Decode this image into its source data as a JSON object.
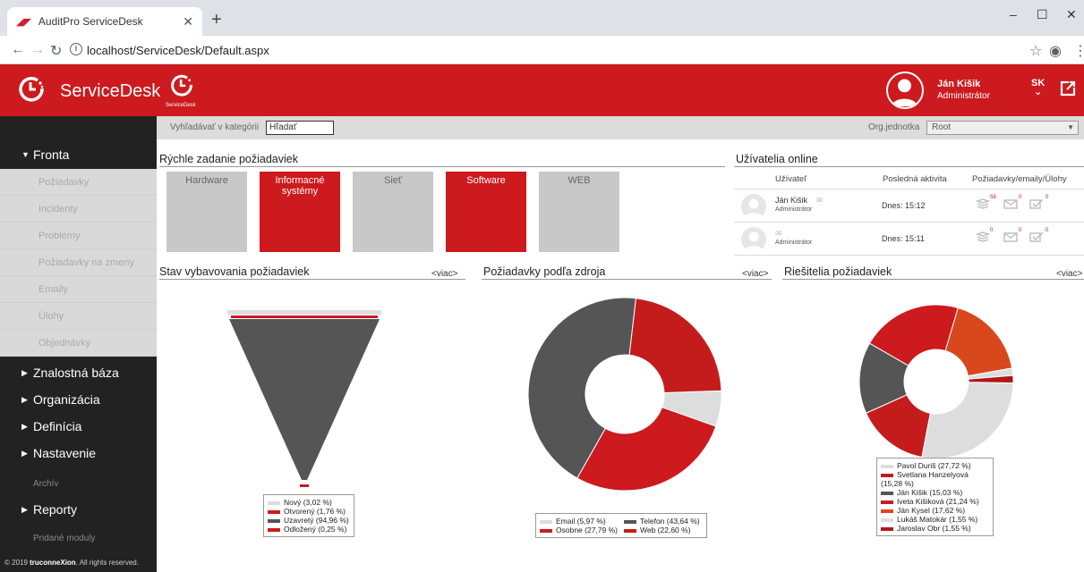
{
  "browser": {
    "tab_title": "AuditPro ServiceDesk",
    "url": "localhost/ServiceDesk/Default.aspx"
  },
  "header": {
    "brand": "ServiceDesk",
    "small_logo_text": "ServiceDesk",
    "user_name": "Ján Kišik",
    "user_role": "Administrátor",
    "lang": "SK"
  },
  "sidebar": {
    "fronta": "Fronta",
    "sub_items": [
      "Požiadavky",
      "Incidenty",
      "Problémy",
      "Požiadavky na zmeny",
      "Emaily",
      "Úlohy",
      "Objednávky"
    ],
    "sections": [
      "Znalostná báza",
      "Organizácia",
      "Definícia",
      "Nastavenie"
    ],
    "archiv": "Archív",
    "reporty": "Reporty",
    "pridane": "Pridané moduly",
    "copyright_prefix": "© 2019 ",
    "copyright_brand": "truconneXion",
    "copyright_suffix": ". All rights reserved."
  },
  "filter": {
    "search_label": "Vyhľadávať v kategórii",
    "search_value": "Hľadať",
    "org_label": "Org.jednotka",
    "org_value": "Root"
  },
  "quick": {
    "title": "Rýchle zadanie požiadaviek",
    "tiles": [
      {
        "label": "Hardware",
        "color": "grey"
      },
      {
        "label": "Informacné systémy",
        "color": "red"
      },
      {
        "label": "Sieť",
        "color": "grey"
      },
      {
        "label": "Software",
        "color": "red"
      },
      {
        "label": "WEB",
        "color": "grey"
      }
    ]
  },
  "online": {
    "title": "Užívatelia online",
    "col_user": "Užívateľ",
    "col_activity": "Posledná aktivita",
    "col_counts": "Požiadavky/emaily/Úlohy",
    "rows": [
      {
        "name": "Ján Kišik",
        "role": "Administrátor",
        "time": "Dnes: 15:12",
        "req": "58",
        "mail": "0",
        "task": "0"
      },
      {
        "name": "",
        "role": "Administrátor",
        "time": "Dnes: 15:11",
        "req": "0",
        "mail": "0",
        "task": "0"
      }
    ]
  },
  "widgets": {
    "more": "<viac>",
    "status_title": "Stav vybavovania požiadaviek",
    "source_title": "Požiadavky podľa zdroja",
    "solvers_title": "Riešitelia požiadaviek"
  },
  "colors": {
    "brand_red": "#cc1a1f",
    "dark": "#555555",
    "light": "#dddddd",
    "orange": "#d9481c"
  },
  "chart_data": [
    {
      "type": "funnel",
      "title": "Stav vybavovania požiadaviek",
      "series": [
        {
          "name": "Nový",
          "label": "Nový (3,02 %)",
          "value": 3.02,
          "color": "#dddddd"
        },
        {
          "name": "Otvorený",
          "label": "Otvorený (1,76 %)",
          "value": 1.76,
          "color": "#cc1a1f"
        },
        {
          "name": "Uzavretý",
          "label": "Uzavretý (94,96 %)",
          "value": 94.96,
          "color": "#555555"
        },
        {
          "name": "Odložený",
          "label": "Odložený (0,25 %)",
          "value": 0.25,
          "color": "#cc1a1f"
        }
      ]
    },
    {
      "type": "pie",
      "title": "Požiadavky podľa zdroja",
      "series": [
        {
          "name": "Email",
          "label": "Email (5,97 %)",
          "value": 5.97,
          "color": "#dddddd"
        },
        {
          "name": "Osobne",
          "label": "Osobne (27,79 %)",
          "value": 27.79,
          "color": "#cc1a1f"
        },
        {
          "name": "Telefon",
          "label": "Telefon (43,64 %)",
          "value": 43.64,
          "color": "#555555"
        },
        {
          "name": "Web",
          "label": "Web (22,60 %)",
          "value": 22.6,
          "color": "#c41c1c"
        }
      ]
    },
    {
      "type": "pie",
      "title": "Riešitelia požiadaviek",
      "series": [
        {
          "name": "Pavol Duriš",
          "label": "Pavol Duriš (27,72 %)",
          "value": 27.72,
          "color": "#dddddd"
        },
        {
          "name": "Svetlana Hanzelyová",
          "label": "Svetlana Hanzelyová (15,28 %)",
          "value": 15.28,
          "color": "#c41c1c"
        },
        {
          "name": "Ján Kišik",
          "label": "Ján Kišik (15,03 %)",
          "value": 15.03,
          "color": "#555555"
        },
        {
          "name": "Iveta Kišiková",
          "label": "Iveta Kišiková (21,24 %)",
          "value": 21.24,
          "color": "#cc1a1f"
        },
        {
          "name": "Ján Kysel",
          "label": "Ján Kysel (17,62 %)",
          "value": 17.62,
          "color": "#d9481c"
        },
        {
          "name": "Lukáš Matokár",
          "label": "Lukáš Matokár (1,55 %)",
          "value": 1.55,
          "color": "#dddddd"
        },
        {
          "name": "Jaroslav Obr",
          "label": "Jaroslav Obr (1,55 %)",
          "value": 1.55,
          "color": "#b01818"
        }
      ]
    }
  ]
}
